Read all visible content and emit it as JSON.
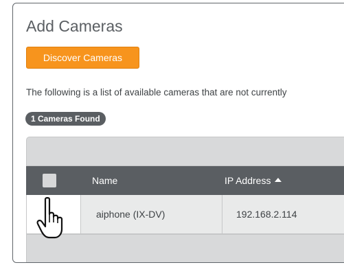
{
  "dialog": {
    "title": "Add Cameras",
    "discover_button": "Discover Cameras",
    "description": "The following is a list of available cameras that are not currently",
    "found_badge": "1 Cameras Found"
  },
  "table": {
    "columns": [
      "Name",
      "IP Address"
    ],
    "sort": {
      "column": "IP Address",
      "direction": "ascending"
    },
    "rows": [
      {
        "name": "aiphone (IX-DV)",
        "ip": "192.168.2.114",
        "checked": false
      }
    ]
  },
  "cursor": {
    "type": "hand-pointer-icon"
  },
  "colors": {
    "accent": "#f7941d",
    "header": "#5a5e62",
    "row": "#e9eaea",
    "toolbar": "#d8d9da"
  }
}
